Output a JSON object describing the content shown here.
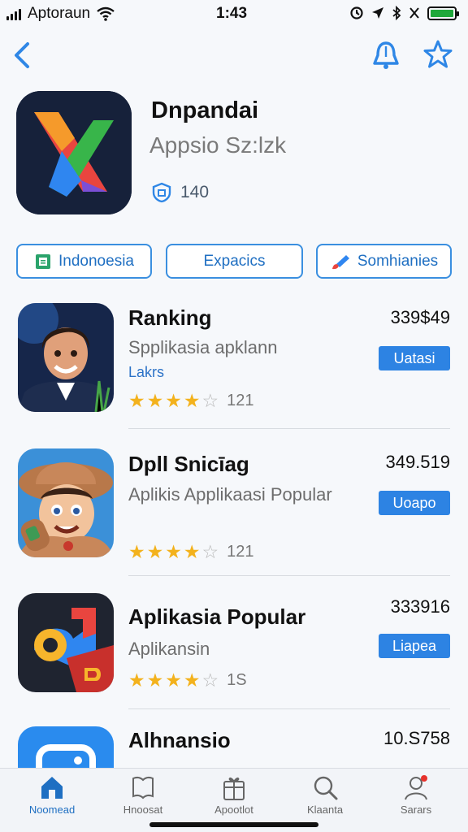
{
  "status_bar": {
    "carrier": "Aptoraun",
    "time": "1:43"
  },
  "app_header": {
    "title": "Dnpandai",
    "subtitle": "Appsio Sz:lzk",
    "rating_count": "140"
  },
  "chips": [
    {
      "label": "Indonoesia",
      "icon": "grid-icon"
    },
    {
      "label": "Expacics",
      "icon": ""
    },
    {
      "label": "Somhianies",
      "icon": "paintbrush-icon"
    }
  ],
  "apps": [
    {
      "name": "Ranking",
      "subtitle": "Spplikasia apklann",
      "subtitle2": "Lakrs",
      "rating": 4,
      "rating_count": "121",
      "price": "339$49",
      "button": "Uatasi"
    },
    {
      "name": "Dpll Snicīag",
      "subtitle": "Aplikis Applikaasi Popular",
      "subtitle2": "",
      "rating": 4,
      "rating_count": "121",
      "price": "349.519",
      "button": "Uoapo"
    },
    {
      "name": "Aplikasia Popular",
      "subtitle": "Aplikansin",
      "subtitle2": "",
      "rating": 4,
      "rating_count": "1S",
      "price": "333916",
      "button": "Liapea"
    },
    {
      "name": "Alhnansio",
      "subtitle": "",
      "subtitle2": "",
      "rating": 0,
      "rating_count": "",
      "price": "10.S758",
      "button": ""
    }
  ],
  "tabs": [
    {
      "label": "Noomead",
      "icon": "home-icon",
      "active": true
    },
    {
      "label": "Hnoosat",
      "icon": "book-icon",
      "active": false
    },
    {
      "label": "Apootlot",
      "icon": "gift-icon",
      "active": false
    },
    {
      "label": "Klaanta",
      "icon": "search-icon",
      "active": false
    },
    {
      "label": "Sarars",
      "icon": "person-icon",
      "active": false
    }
  ],
  "colors": {
    "accent": "#2d83e3",
    "star": "#f3b21d",
    "battery": "#1fa83b"
  }
}
